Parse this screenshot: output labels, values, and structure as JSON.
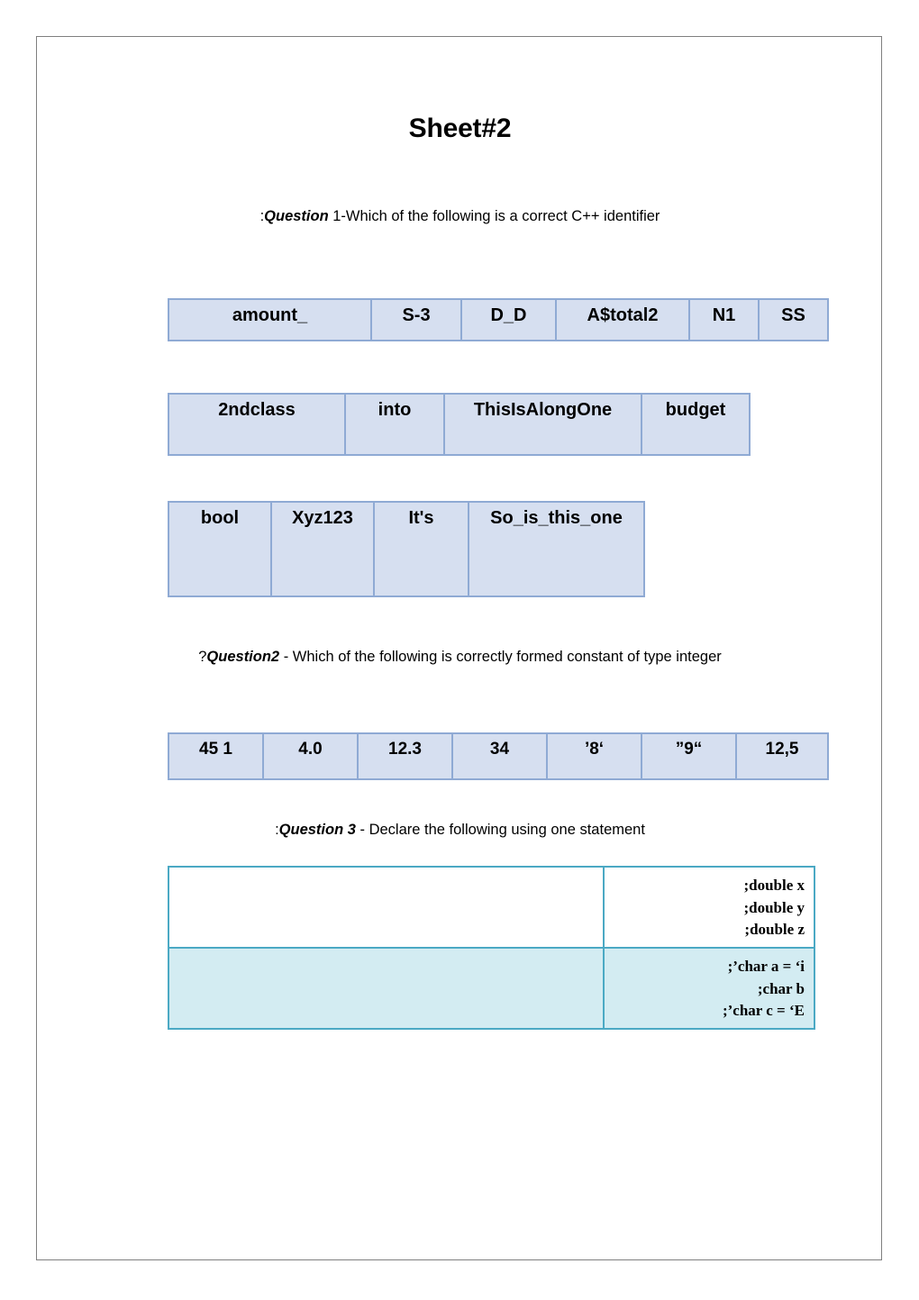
{
  "document": {
    "title": "Sheet#2",
    "border_color": "#7f7f7f"
  },
  "questions": {
    "q1": {
      "prefix": ":",
      "label": "Question",
      "text": " 1-Which of the following is a correct C++ identifier"
    },
    "q2": {
      "prefix": "?",
      "label": "Question2",
      "text": " - Which of the following is correctly formed constant of type integer"
    },
    "q3": {
      "prefix": ":",
      "label": "Question 3",
      "text": " - Declare the following using one statement"
    }
  },
  "theme": {
    "table_fill": "#d6dff0",
    "table_border": "#8faad4",
    "decl_border": "#4ba9c4",
    "decl_fill": "#d3ecf2",
    "decl_fill_white": "#ffffff"
  },
  "tables": {
    "identifiers_row1": [
      "amount_",
      "S-3",
      "D_D",
      "A$total2",
      "N1",
      "SS"
    ],
    "identifiers_row2": [
      "2ndclass",
      "into",
      "ThisIsAlongOne",
      "budget"
    ],
    "identifiers_row3": [
      "bool",
      "Xyz123",
      "It's",
      "So_is_this_one"
    ],
    "constants_row": [
      "45 1",
      "4.0",
      "12.3",
      "34",
      "’8‘",
      "”9“",
      "12,5"
    ]
  },
  "declarations": {
    "rows": [
      {
        "left": "",
        "right": [
          ";double x",
          ";double y",
          ";double z"
        ]
      },
      {
        "left": "",
        "right": [
          ";’char a = ‘i",
          ";char b",
          ";’char c = ‘E"
        ]
      }
    ]
  }
}
